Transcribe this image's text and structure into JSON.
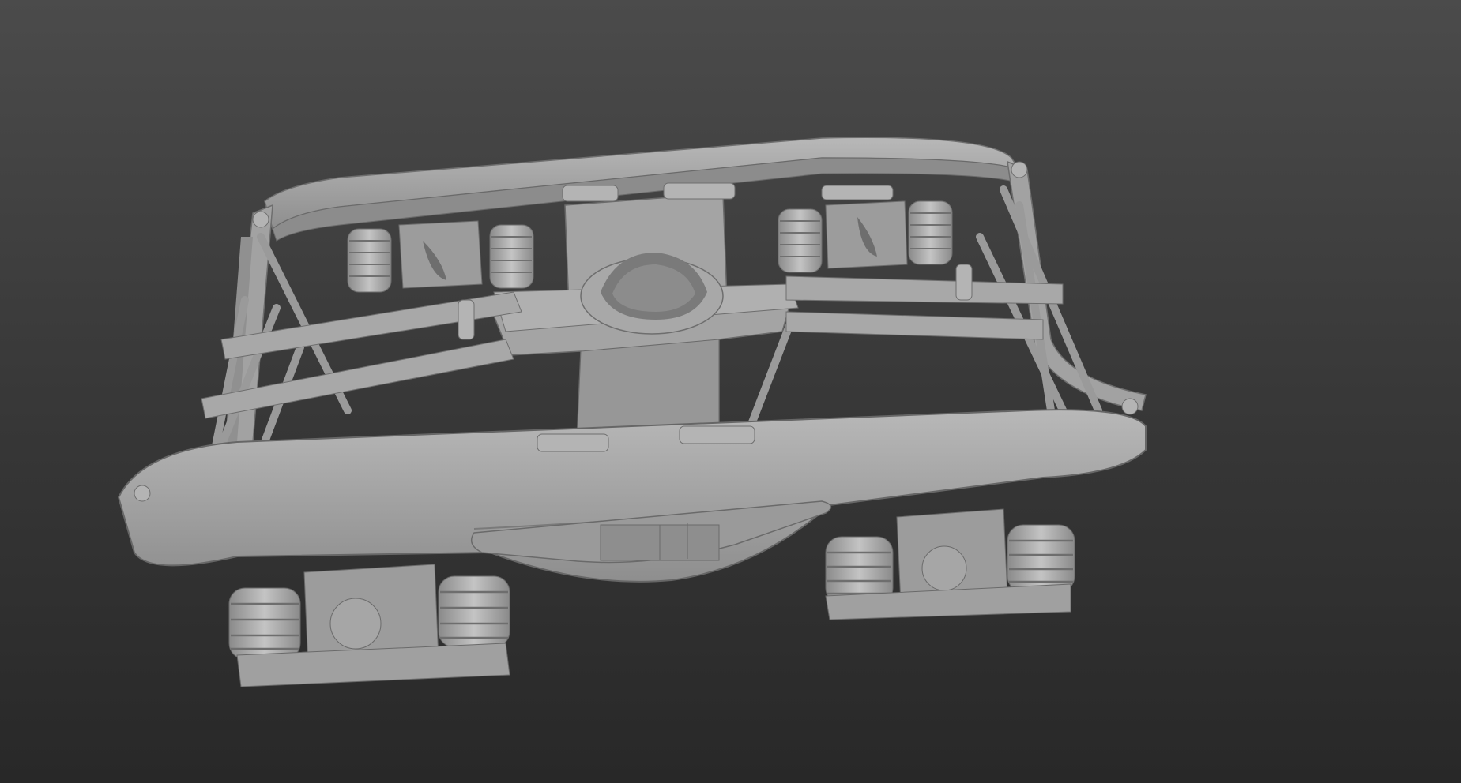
{
  "viewport": {
    "background_top": "#4b4b4b",
    "background_bottom": "#282828",
    "model_color": "#a6a6a6",
    "model_light": "#bdbdbd",
    "model_dark": "#7c7c7c",
    "model_shadow": "#5e5e5e"
  }
}
